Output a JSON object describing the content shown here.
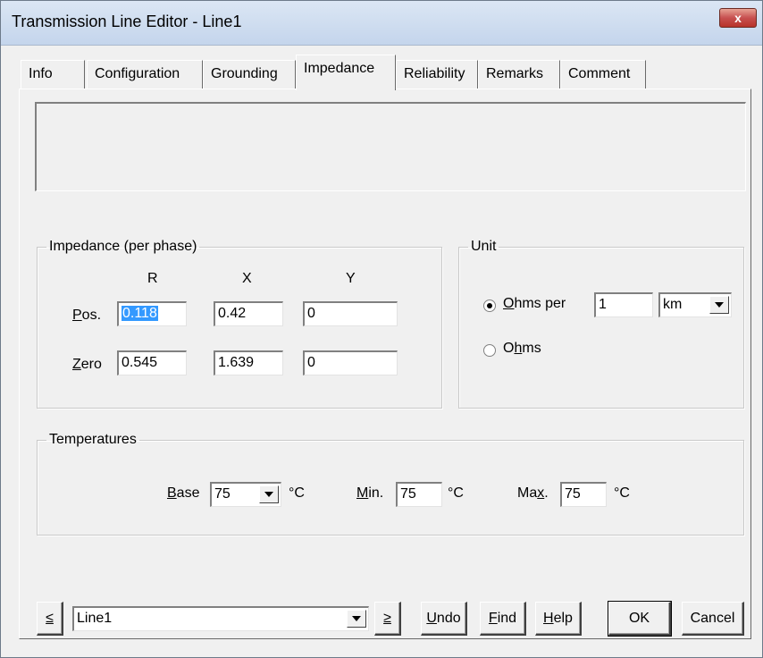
{
  "window": {
    "title": "Transmission Line Editor - Line1",
    "close_label": "x"
  },
  "tabs": [
    {
      "label": "Info"
    },
    {
      "label": "Configuration"
    },
    {
      "label": "Grounding"
    },
    {
      "label": "Impedance"
    },
    {
      "label": "Reliability"
    },
    {
      "label": "Remarks"
    },
    {
      "label": "Comment"
    }
  ],
  "active_tab": "Impedance",
  "impedance": {
    "legend": "Impedance (per phase)",
    "col_r": "R",
    "col_x": "X",
    "col_y": "Y",
    "pos_label_mn": "P",
    "pos_label_rest": "os.",
    "zero_label_mn": "Z",
    "zero_label_rest": "ero",
    "pos": {
      "r": "0.118",
      "x": "0.42",
      "y": "0"
    },
    "zero": {
      "r": "0.545",
      "x": "1.639",
      "y": "0"
    }
  },
  "unit": {
    "legend": "Unit",
    "ohms_per_mn": "O",
    "ohms_per_rest": "hms per",
    "ohms_per_value": "1",
    "length_unit": "km",
    "ohms_pre": "O",
    "ohms_mn": "h",
    "ohms_rest": "ms",
    "selected": "ohms_per"
  },
  "temperatures": {
    "legend": "Temperatures",
    "base_mn": "B",
    "base_rest": "ase",
    "base_value": "75",
    "min_mn": "M",
    "min_rest": "in.",
    "min_value": "75",
    "max_pre": "Ma",
    "max_mn": "x",
    "max_rest": ".",
    "max_value": "75",
    "unit": "°C"
  },
  "footer": {
    "prev_label": "≤",
    "next_label": "≥",
    "line_select": "Line1",
    "undo_mn": "U",
    "undo_rest": "ndo",
    "find_mn": "F",
    "find_rest": "ind",
    "help_mn": "H",
    "help_rest": "elp",
    "ok_label": "OK",
    "cancel_label": "Cancel"
  }
}
